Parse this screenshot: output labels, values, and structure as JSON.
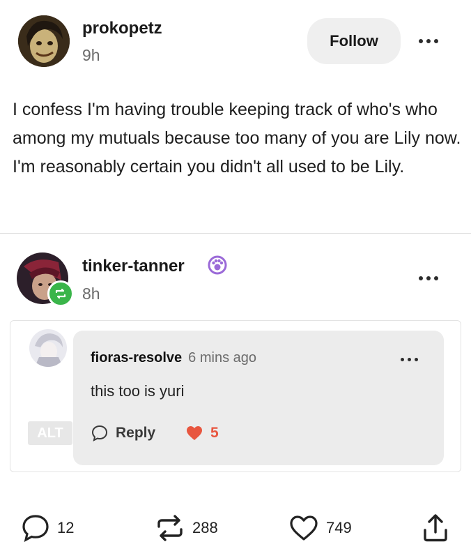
{
  "post": {
    "author": "prokopetz",
    "time": "9h",
    "follow_label": "Follow",
    "body": "I confess I'm having trouble keeping track of who's who among my mutuals because too many of you are Lily now. I'm reasonably certain you didn't all used to be Lily."
  },
  "reblog": {
    "author": "tinker-tanner",
    "time": "8h"
  },
  "comment": {
    "author": "fioras-resolve",
    "time": "6 mins ago",
    "text": "this too is yuri",
    "alt_label": "ALT",
    "reply_label": "Reply",
    "like_count": "5"
  },
  "footer": {
    "comments": "12",
    "reblogs": "288",
    "likes": "749"
  },
  "icons": {
    "comment": "speech-bubble-icon",
    "reblog": "reblog-arrows-icon",
    "like": "heart-icon",
    "share": "share-upload-icon",
    "badge": "paw-badge-icon"
  },
  "colors": {
    "heart_red": "#e8563f",
    "reblog_badge_green": "#3ab54a",
    "badge_purple": "#9b6ad8"
  }
}
